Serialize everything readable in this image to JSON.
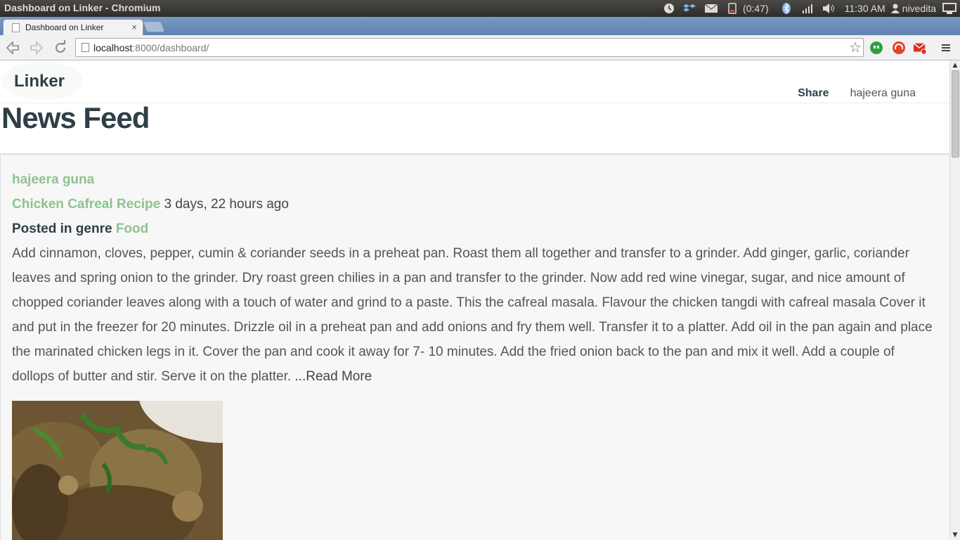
{
  "system": {
    "window_title": "Dashboard on Linker - Chromium",
    "battery": "(0:47)",
    "clock": "11:30 AM",
    "user": "nivedita"
  },
  "browser": {
    "tab_title": "Dashboard on Linker",
    "tab_close": "×",
    "url_host": "localhost",
    "url_rest": ":8000/dashboard/"
  },
  "site": {
    "logo": "Linker",
    "nav_share": "Share",
    "nav_user": "hajeera guna",
    "page_title": "News Feed"
  },
  "post": {
    "author": "hajeera guna",
    "title": "Chicken Cafreal Recipe",
    "time": "3 days, 22 hours ago",
    "genre_prefix": "Posted in genre",
    "genre": "Food",
    "body": "Add cinnamon, cloves, pepper, cumin & coriander seeds in a preheat pan. Roast them all together and transfer to a grinder. Add ginger, garlic, coriander leaves and spring onion to the grinder. Dry roast green chilies in a pan and transfer to the grinder. Now add red wine vinegar, sugar, and nice amount of chopped coriander leaves along with a touch of water and grind to a paste. This the cafreal masala. Flavour the chicken tangdi with cafreal masala Cover it and put in the freezer for 20 minutes. Drizzle oil in a preheat pan and add onions and fry them well. Transfer it to a platter. Add oil in the pan again and place the marinated chicken legs in it. Cover the pan and cook it away for 7- 10 minutes. Add the fried onion back to the pan and mix it well. Add a couple of dollops of butter and stir. Serve it on the platter. ",
    "read_more": "...Read More"
  }
}
